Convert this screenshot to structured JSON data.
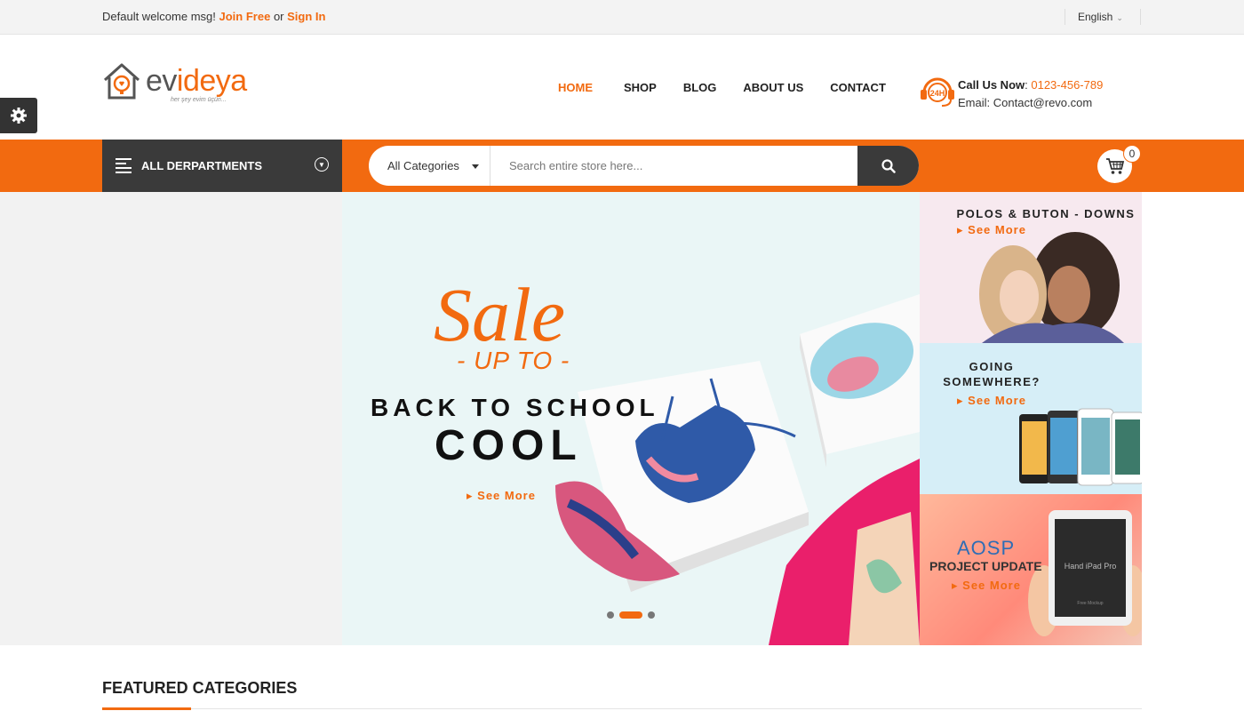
{
  "topbar": {
    "welcome": "Default welcome msg!",
    "join": "Join Free",
    "or": "or",
    "signin": "Sign In",
    "language": "English"
  },
  "logo": {
    "name_part1": "ev",
    "name_part2": "ideya",
    "tagline": "her şey evim üçün..."
  },
  "nav": [
    "HOME",
    "SHOP",
    "BLOG",
    "ABOUT US",
    "CONTACT"
  ],
  "contact": {
    "call_label": "Call Us Now",
    "phone": "0123-456-789",
    "email_label": "Email:",
    "email": "Contact@revo.com",
    "badge": "24H"
  },
  "departments": {
    "label": "ALL DERPARTMENTS"
  },
  "search": {
    "category": "All Categories",
    "placeholder": "Search entire store here..."
  },
  "cart": {
    "count": "0"
  },
  "hero": {
    "sale": "Sale",
    "upto": "- UP TO -",
    "line1": "BACK TO SCHOOL",
    "line2": "COOL",
    "see_more": "See More",
    "slides": 3,
    "active_slide": 2
  },
  "banners": [
    {
      "title": "POLOS & BUTON - DOWNS",
      "see_more": "See More"
    },
    {
      "title_line1": "GOING",
      "title_line2": "SOMEWHERE?",
      "see_more": "See More"
    },
    {
      "title_line1": "AOSP",
      "title_line2": "PROJECT UPDATE",
      "see_more": "See More",
      "device_text": "Hand iPad Pro",
      "device_sub": "Free Mockup"
    }
  ],
  "featured": {
    "title": "FEATURED CATEGORIES"
  },
  "colors": {
    "accent": "#f26a10",
    "dark": "#3a3a3a"
  }
}
